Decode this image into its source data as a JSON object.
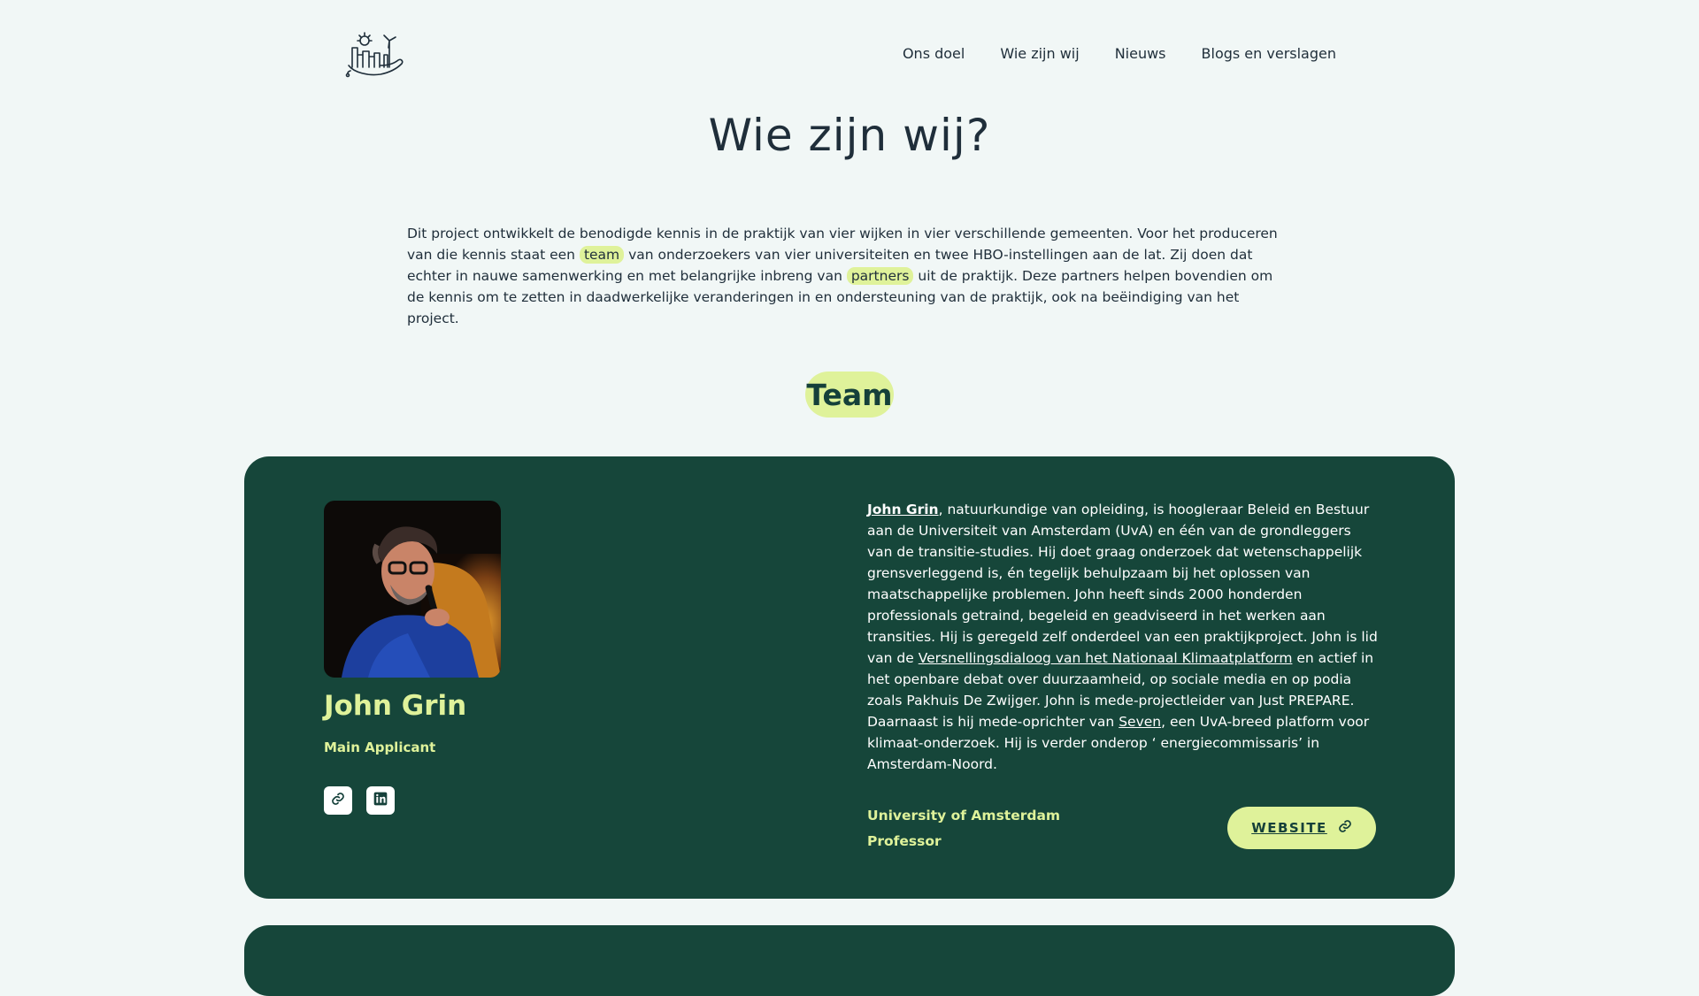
{
  "nav": {
    "items": [
      "Ons doel",
      "Wie zijn wij",
      "Nieuws",
      "Blogs en verslagen"
    ]
  },
  "page": {
    "title": "Wie zijn wij?"
  },
  "intro": {
    "part1": "Dit project ontwikkelt de benodigde kennis in de praktijk van vier wijken in vier verschillende gemeenten. Voor het produceren van die kennis staat een ",
    "team_link": "team",
    "part2": " van onderzoekers van vier universiteiten en twee HBO-instellingen aan de lat. Zij doen dat echter in nauwe samenwerking en met belangrijke inbreng van ",
    "partners_link": "partners",
    "part3": " uit de praktijk. Deze partners helpen bovendien om de kennis om te zetten in daadwerkelijke veranderingen in en ondersteuning van de praktijk, ook na beëindiging van het project."
  },
  "team_heading": "Team",
  "member": {
    "name": "John Grin",
    "role": "Main Applicant",
    "bio": {
      "name_link": "John Grin",
      "t1": ", natuurkundige van opleiding, is hoogleraar Beleid en Bestuur aan de Universiteit van Amsterdam (UvA) en één van de grondleggers van de transitie-studies. Hij doet graag onderzoek dat wetenschappelijk grensverleggend is, én tegelijk behulpzaam bij het oplossen van maatschappelijke problemen. John heeft sinds 2000 honderden professionals getraind, begeleid en geadviseerd in het werken aan transities. Hij is geregeld zelf onderdeel van een praktijkproject. John is lid van de ",
      "link1": "Versnellingsdialoog van het Nationaal Klimaatplatform",
      "t2": " en actief in het openbare debat over duurzaamheid, op sociale media en op podia zoals Pakhuis De Zwijger. John is mede-projectleider van Just PREPARE. Daarnaast is hij mede-oprichter van ",
      "link2": "Seven",
      "t3": ", een UvA-breed platform voor klimaat-onderzoek. Hij is verder onderop ‘ energiecommissaris’ in Amsterdam-Noord."
    },
    "organization": "University of Amsterdam",
    "position": "Professor",
    "website_label": "WEBSITE"
  },
  "colors": {
    "background": "#f1f7f6",
    "card": "#16463a",
    "accent": "#dff29a",
    "text": "#1f2e3a"
  },
  "icons": [
    "logo-icon",
    "link-icon",
    "linkedin-icon"
  ]
}
